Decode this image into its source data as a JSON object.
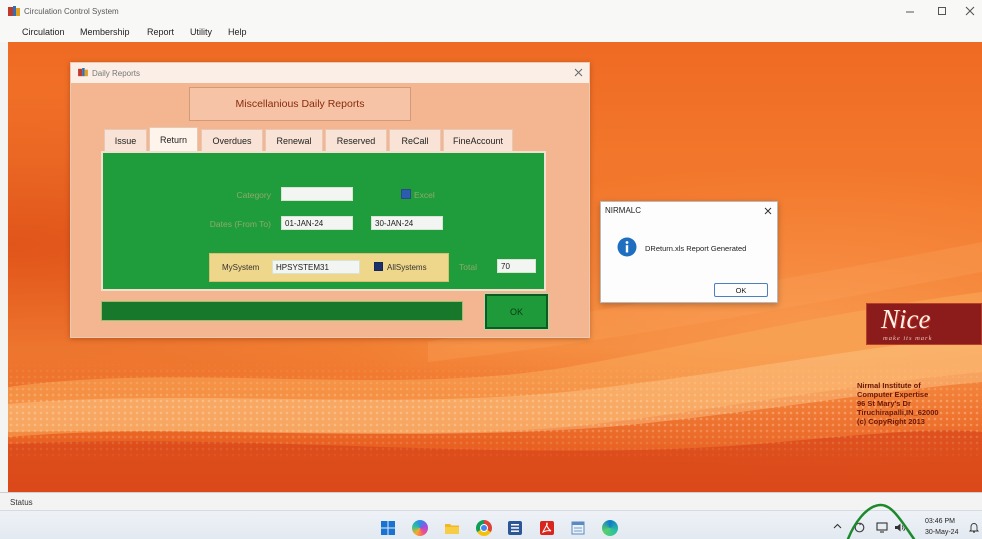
{
  "theme": {
    "desktop_orange": "#f2762b",
    "dialog_peach": "#f3b690",
    "panel_green": "#1f9d3d",
    "progress_green": "#17782b",
    "yellow_panel": "#eed68a",
    "checkbox_blue": "#2b5cb0",
    "logo_red": "#8c1c1c",
    "annotation_green": "#1c8a2c",
    "info_blue": "#1f6fc0"
  },
  "window": {
    "title": "Circulation Control System",
    "icon": "app-icon",
    "controls": [
      "minimize-icon",
      "maximize-icon",
      "close-icon"
    ]
  },
  "menu": {
    "items": [
      "Circulation",
      "Membership",
      "Report",
      "Utility",
      "Help"
    ]
  },
  "daily_reports": {
    "title": "Daily Reports",
    "icon": "app-icon",
    "header": "Miscellanious Daily Reports",
    "tabs": [
      "Issue",
      "Return",
      "Overdues",
      "Renewal",
      "Reserved",
      "ReCall",
      "FineAccount"
    ],
    "selected_tab": 1,
    "category": {
      "label": "Category",
      "value": ""
    },
    "excel": {
      "label": "Excel",
      "checked": true
    },
    "dates": {
      "label": "Dates (From To)",
      "from": "01-JAN-24",
      "to": "30-JAN-24"
    },
    "mysystem": {
      "label": "MySystem",
      "value": "HPSYSTEM31"
    },
    "all_systems": {
      "label": "AllSystems",
      "checked": true
    },
    "total": {
      "label": "Total",
      "value": "70"
    },
    "progress_percent": 100,
    "ok_label": "OK"
  },
  "message_box": {
    "title": "NIRMALC",
    "icon": "info-icon",
    "message": "DReturn.xls Report Generated",
    "ok_label": "OK"
  },
  "branding": {
    "logo_text": "Nice",
    "logo_tagline": "make its mark",
    "address_lines": [
      "Nirmal Institute of",
      "Computer Expertise",
      "96 St Mary's Dr",
      "Tiruchirapalli,IN_62000",
      "(c) CopyRight 2013"
    ]
  },
  "status_bar": {
    "label": "Status"
  },
  "taskbar": {
    "pinned_icons": [
      "windows-start-icon",
      "copilot-icon",
      "file-explorer-icon",
      "chrome-icon",
      "word-icon",
      "acrobat-icon",
      "notepad-icon",
      "edge-icon"
    ],
    "tray_icons": [
      "chevron-up-icon",
      "sync-icon",
      "network-icon",
      "speaker-icon",
      "bell-icon"
    ],
    "time": "03:46 PM",
    "date": "30-May-24"
  }
}
